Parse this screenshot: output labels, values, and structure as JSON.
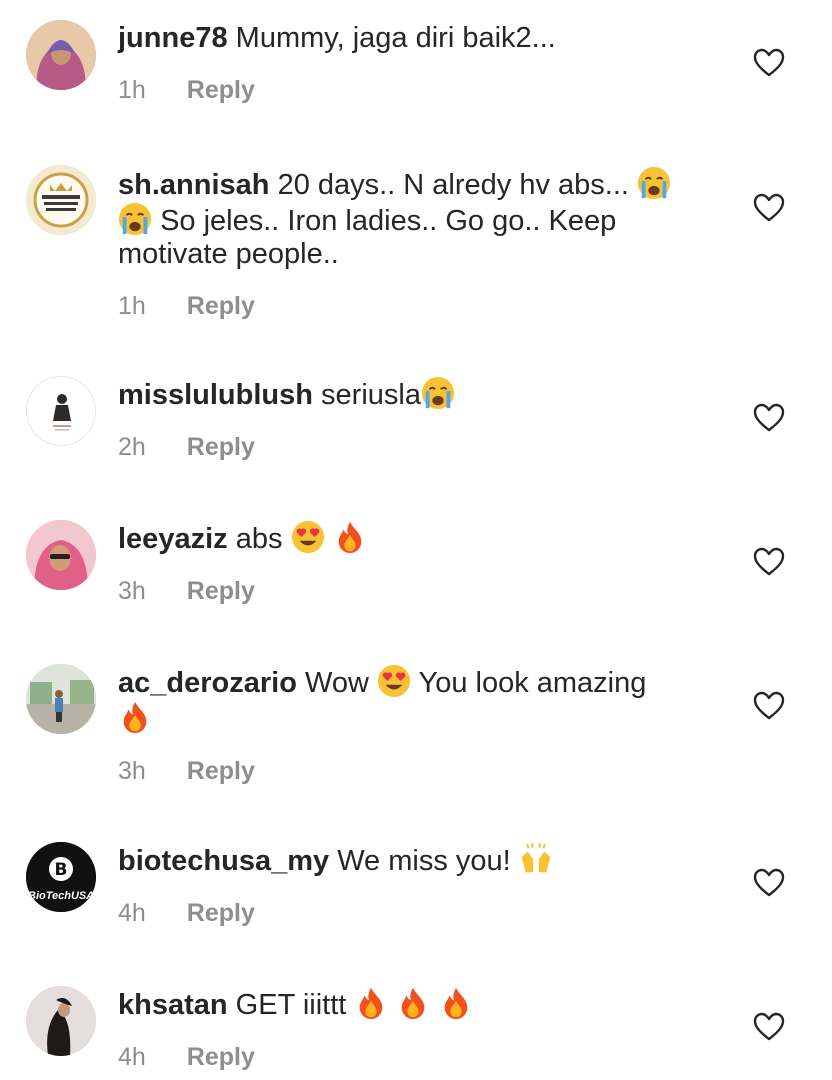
{
  "comments": [
    {
      "user": "junne78",
      "text": "Mummy, jaga diri baik2...",
      "time": "1h",
      "reply": "Reply",
      "avatar_icon": "woman-hijab-avatar",
      "avatar_color": "#c9a0b0"
    },
    {
      "user": "sh.annisah",
      "text": "20 days.. N alredy hv abs...",
      "text2": "So jeles.. Iron ladies.. Go go.. Keep",
      "text3": "motivate people..",
      "time": "1h",
      "reply": "Reply",
      "avatar_icon": "gold-logo-avatar",
      "avatar_color": "#e7d8a0"
    },
    {
      "user": "misslulublush",
      "text": "seriusla",
      "time": "2h",
      "reply": "Reply",
      "avatar_icon": "figure-logo-avatar",
      "avatar_color": "#ffffff"
    },
    {
      "user": "leeyaziz",
      "text": "abs",
      "time": "3h",
      "reply": "Reply",
      "avatar_icon": "woman-pink-avatar",
      "avatar_color": "#e47a9c"
    },
    {
      "user": "ac_derozario",
      "text": "Wow",
      "text2": "You look amazing",
      "time": "3h",
      "reply": "Reply",
      "avatar_icon": "outdoor-person-avatar",
      "avatar_color": "#a7b79a"
    },
    {
      "user": "biotechusa_my",
      "text": "We miss you!",
      "time": "4h",
      "reply": "Reply",
      "avatar_icon": "biotechusa-logo-avatar",
      "avatar_color": "#111111",
      "avatar_label": "BioTechUSA"
    },
    {
      "user": "khsatan",
      "text": "GET iiittt",
      "time": "4h",
      "reply": "Reply",
      "avatar_icon": "woman-dark-avatar",
      "avatar_color": "#d8d3d0"
    }
  ],
  "icons": {
    "like": "heart-outline-icon",
    "cry": "crying-face-emoji",
    "love": "heart-eyes-emoji",
    "fire": "fire-emoji",
    "praise": "raised-hands-emoji"
  },
  "colors": {
    "text": "#262626",
    "muted": "#8e8e8e",
    "background": "#ffffff"
  }
}
